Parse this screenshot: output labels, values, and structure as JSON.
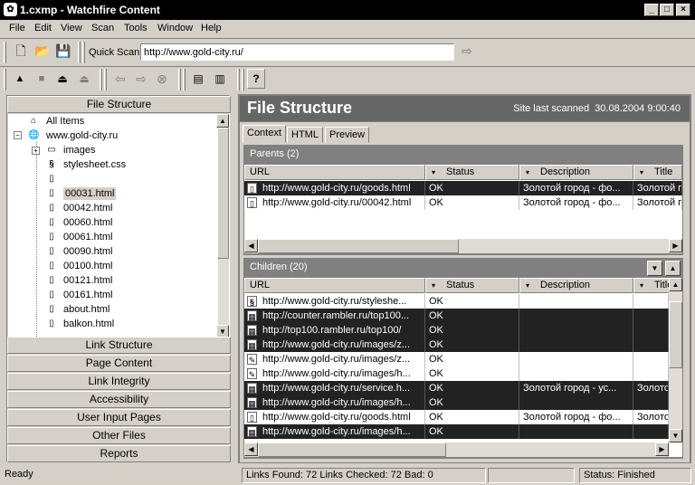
{
  "window": {
    "title": "1.cxmp - Watchfire Content",
    "min": "_",
    "max": "□",
    "close": "×"
  },
  "menu": [
    "File",
    "Edit",
    "View",
    "Scan",
    "Tools",
    "Window",
    "Help"
  ],
  "quickscan": {
    "label": "Quick Scan:",
    "value": "http://www.gold-city.ru/"
  },
  "left": {
    "top_button": "File Structure",
    "tree": {
      "root": "All Items",
      "site": "www.gold-city.ru",
      "items": [
        "images",
        "stylesheet.css",
        "",
        "00031.html",
        "00042.html",
        "00060.html",
        "00061.html",
        "00090.html",
        "00100.html",
        "00121.html",
        "00161.html",
        "about.html",
        "balkon.html"
      ]
    },
    "buttons": [
      "Link Structure",
      "Page Content",
      "Link Integrity",
      "Accessibility",
      "User Input Pages",
      "Other Files",
      "Reports"
    ]
  },
  "right": {
    "title": "File Structure",
    "last_scanned": "Site last scanned  30.08.2004 9:00:40",
    "tabs": [
      "Context",
      "HTML",
      "Preview"
    ],
    "parents": {
      "header": "Parents (2)",
      "columns": [
        "URL",
        "Status",
        "Description",
        "Title"
      ],
      "rows": [
        {
          "url": "http://www.gold-city.ru/goods.html",
          "status": "OK",
          "desc": "Золотой город - фо...",
          "title": "Золотой г"
        },
        {
          "url": "http://www.gold-city.ru/00042.html",
          "status": "OK",
          "desc": "Золотой город - фо...",
          "title": "Золотой г"
        }
      ]
    },
    "children": {
      "header": "Children (20)",
      "columns": [
        "URL",
        "Status",
        "Description",
        "Title"
      ],
      "rows": [
        {
          "url": "http://www.gold-city.ru/styleshe...",
          "status": "OK",
          "desc": "",
          "title": ""
        },
        {
          "url": "http://counter.rambler.ru/top100...",
          "status": "OK",
          "desc": "",
          "title": ""
        },
        {
          "url": "http://top100.rambler.ru/top100/",
          "status": "OK",
          "desc": "",
          "title": ""
        },
        {
          "url": "http://www.gold-city.ru/images/z...",
          "status": "OK",
          "desc": "",
          "title": ""
        },
        {
          "url": "http://www.gold-city.ru/images/z...",
          "status": "OK",
          "desc": "",
          "title": ""
        },
        {
          "url": "http://www.gold-city.ru/images/h...",
          "status": "OK",
          "desc": "",
          "title": ""
        },
        {
          "url": "http://www.gold-city.ru/service.h...",
          "status": "OK",
          "desc": "Золотой город - ус...",
          "title": "Золото"
        },
        {
          "url": "http://www.gold-city.ru/images/h...",
          "status": "OK",
          "desc": "",
          "title": ""
        },
        {
          "url": "http://www.gold-city.ru/goods.html",
          "status": "OK",
          "desc": "Золотой город - фо...",
          "title": "Золото"
        },
        {
          "url": "http://www.gold-city.ru/images/h...",
          "status": "OK",
          "desc": "",
          "title": ""
        }
      ]
    }
  },
  "status": {
    "ready": "Ready",
    "links": "Links Found: 72  Links Checked: 72  Bad: 0",
    "state": "Status: Finished"
  }
}
